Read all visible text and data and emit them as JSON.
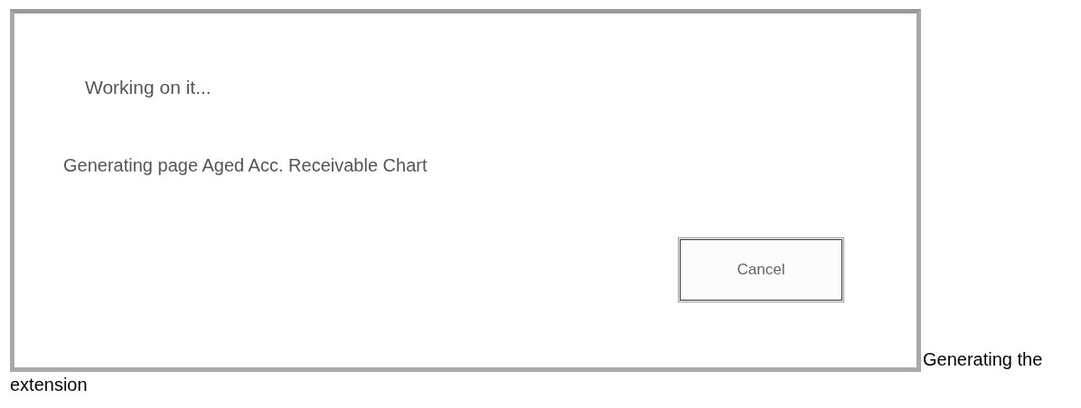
{
  "dialog": {
    "title": "Working on it...",
    "message": "Generating page Aged Acc. Receivable Chart",
    "buttons": [
      {
        "label": "Cancel"
      }
    ]
  },
  "caption": "Generating the extension"
}
